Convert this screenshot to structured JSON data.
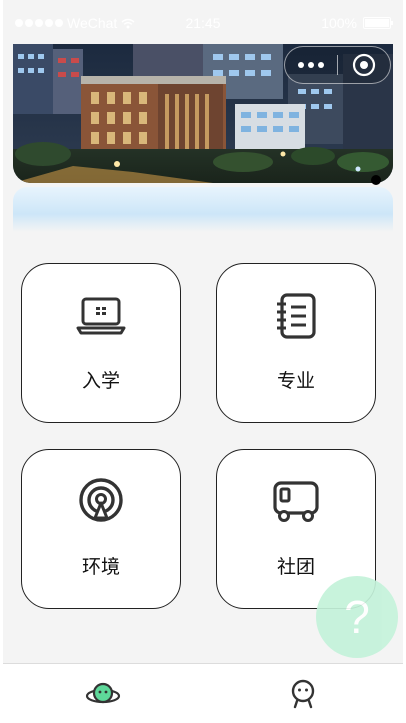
{
  "status_bar": {
    "carrier": "WeChat",
    "time": "21:45",
    "battery": "100%",
    "icons": [
      "signal-dots-icon",
      "wifi-icon",
      "battery-icon"
    ]
  },
  "capsule": {
    "icons": [
      "more-dots-icon",
      "close-target-icon"
    ]
  },
  "banner": {
    "image": "campus-night-photo",
    "active_slide_indicator": true
  },
  "grid": {
    "items": [
      {
        "label": "入学",
        "icon": "laptop-icon"
      },
      {
        "label": "专业",
        "icon": "notebook-icon"
      },
      {
        "label": "环境",
        "icon": "broadcast-icon"
      },
      {
        "label": "社团",
        "icon": "bus-icon"
      }
    ]
  },
  "help_button": {
    "label": "?",
    "color": "#c4f2da"
  },
  "tabbar": {
    "items": [
      {
        "icon": "planet-icon",
        "active": true
      },
      {
        "icon": "person-icon",
        "active": false
      }
    ]
  },
  "colors": {
    "page_background": "#f4f4f4",
    "card_border": "#222222",
    "accent_green": "#5ed89a"
  }
}
